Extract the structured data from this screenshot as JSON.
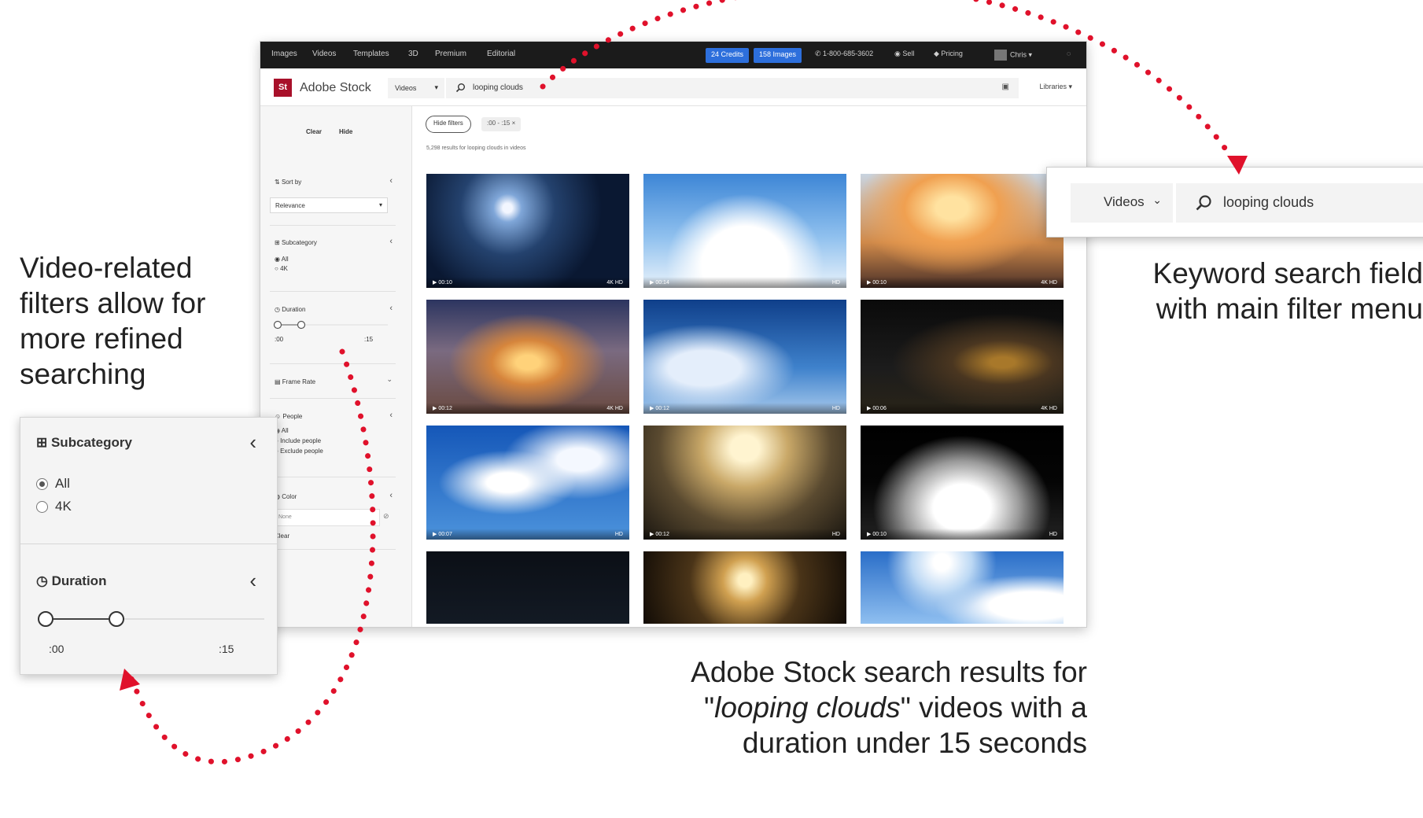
{
  "topnav": {
    "items": [
      "Images",
      "Videos",
      "Templates",
      "3D",
      "Premium",
      "Editorial"
    ],
    "credits_button": "24 Credits",
    "images_button": "158 Images",
    "phone": "1-800-685-3602",
    "sell": "Sell",
    "pricing": "Pricing",
    "user": "Chris"
  },
  "header": {
    "logo": "St",
    "brand": "Adobe Stock",
    "asset_type": "Videos",
    "search_query": "looping clouds",
    "libraries": "Libraries"
  },
  "sidebar": {
    "clear": "Clear",
    "hide": "Hide",
    "sort_label": "Sort by",
    "sort_value": "Relevance",
    "subcategory_label": "Subcategory",
    "subcategory_options": [
      "All",
      "4K"
    ],
    "duration_label": "Duration",
    "duration_min": ":00",
    "duration_max": ":15",
    "frame_rate_label": "Frame Rate",
    "people_label": "People",
    "people_options": [
      "All",
      "Include people",
      "Exclude people"
    ],
    "color_label": "Color",
    "color_placeholder": "None",
    "color_clear": "Clear"
  },
  "content": {
    "hide_filters": "Hide filters",
    "active_chip": ":00 - :15 ×",
    "results_text": "5,298 results for looping clouds in videos"
  },
  "thumbnails": [
    {
      "duration": "00:10",
      "res": "4K HD",
      "palette": "night"
    },
    {
      "duration": "00:14",
      "res": "HD",
      "palette": "daysky"
    },
    {
      "duration": "00:10",
      "res": "4K HD",
      "palette": "sunset"
    },
    {
      "duration": "00:12",
      "res": "4K HD",
      "palette": "dusk"
    },
    {
      "duration": "00:12",
      "res": "HD",
      "palette": "blue"
    },
    {
      "duration": "00:06",
      "res": "4K HD",
      "palette": "storm"
    },
    {
      "duration": "00:07",
      "res": "HD",
      "palette": "cirrus"
    },
    {
      "duration": "00:12",
      "res": "HD",
      "palette": "rays"
    },
    {
      "duration": "00:10",
      "res": "HD",
      "palette": "smoke"
    },
    {
      "duration": "",
      "res": "",
      "palette": "dark"
    },
    {
      "duration": "",
      "res": "",
      "palette": "burst"
    },
    {
      "duration": "",
      "res": "",
      "palette": "bright"
    }
  ],
  "zoom_search": {
    "asset_type": "Videos",
    "query": "looping clouds"
  },
  "zoom_filter": {
    "subcategory_label": "Subcategory",
    "options": [
      "All",
      "4K"
    ],
    "duration_label": "Duration",
    "min": ":00",
    "max": ":15"
  },
  "annotations": {
    "left": [
      "Video-related",
      "filters allow for",
      "more refined",
      "searching"
    ],
    "right": [
      "Keyword search field",
      "with main filter menu"
    ],
    "bottom_line1": "Adobe Stock search results for",
    "bottom_quote_open": "\"",
    "bottom_italic": "looping clouds",
    "bottom_line2_rest": "\" videos with a",
    "bottom_line3": "duration under 15 seconds"
  },
  "colors": {
    "accent_red": "#e0112b",
    "credit_blue": "#2d6fdc",
    "logo_red": "#a8102a"
  }
}
